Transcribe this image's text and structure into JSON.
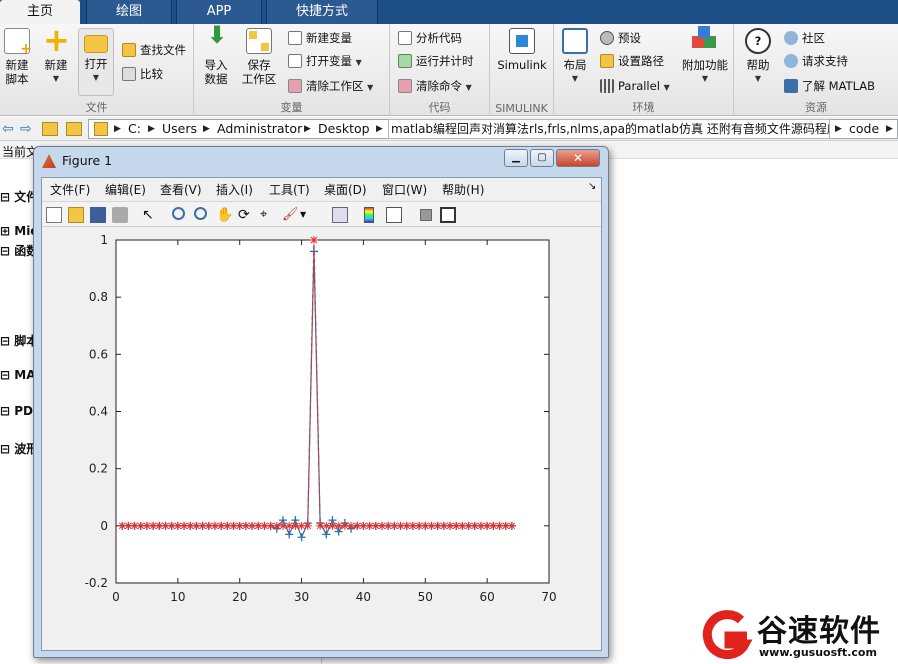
{
  "tabs": [
    "主页",
    "绘图",
    "APP",
    "快捷方式"
  ],
  "ribbon": {
    "file": {
      "label": "文件",
      "new_script": "新建\n脚本",
      "new": "新建",
      "open": "打开",
      "find_files": "查找文件",
      "compare": "比较"
    },
    "variable": {
      "label": "变量",
      "import_data": "导入\n数据",
      "save_workspace": "保存\n工作区",
      "new_variable": "新建变量",
      "open_variable": "打开变量",
      "clear_workspace": "清除工作区"
    },
    "code": {
      "label": "代码",
      "analyze_code": "分析代码",
      "run_and_time": "运行并计时",
      "clear_commands": "清除命令"
    },
    "simulink": {
      "label": "SIMULINK",
      "button": "Simulink"
    },
    "environment": {
      "label": "环境",
      "layout": "布局",
      "preferences": "预设",
      "set_path": "设置路径",
      "parallel": "Parallel",
      "addons": "附加功能"
    },
    "resources": {
      "label": "资源",
      "help": "帮助",
      "community": "社区",
      "request_support": "请求支持",
      "learn_matlab": "了解 MATLAB"
    }
  },
  "address": {
    "drive": "C:",
    "segments": [
      "Users",
      "Administrator",
      "Desktop",
      "matlab编程回声对消算法rls,frls,nlms,apa的matlab仿真 还附有音频文件源码程序",
      "code"
    ]
  },
  "left_panel": {
    "header": "当前文",
    "items": [
      "文件",
      "Mic",
      "函数",
      "脚本",
      "MA",
      "PDF",
      "波形"
    ]
  },
  "figure": {
    "title": "Figure 1",
    "menu": [
      "文件(F)",
      "编辑(E)",
      "查看(V)",
      "插入(I)",
      "工具(T)",
      "桌面(D)",
      "窗口(W)",
      "帮助(H)"
    ]
  },
  "chart_data": {
    "type": "line",
    "x_ticks": [
      0,
      10,
      20,
      30,
      40,
      50,
      60,
      70
    ],
    "y_ticks": [
      -0.2,
      0,
      0.2,
      0.4,
      0.6,
      0.8,
      1
    ],
    "xlim": [
      0,
      70
    ],
    "ylim": [
      -0.2,
      1
    ],
    "grid": false,
    "series": [
      {
        "marker": "*",
        "color": "#e0312f",
        "linestyle": "dashed",
        "x": [
          1,
          2,
          3,
          4,
          5,
          6,
          7,
          8,
          9,
          10,
          11,
          12,
          13,
          14,
          15,
          16,
          17,
          18,
          19,
          20,
          21,
          22,
          23,
          24,
          25,
          26,
          27,
          28,
          29,
          30,
          31,
          32,
          33,
          34,
          35,
          36,
          37,
          38,
          39,
          40,
          41,
          42,
          43,
          44,
          45,
          46,
          47,
          48,
          49,
          50,
          51,
          52,
          53,
          54,
          55,
          56,
          57,
          58,
          59,
          60,
          61,
          62,
          63,
          64
        ],
        "y": [
          0,
          0,
          0,
          0,
          0,
          0,
          0,
          0,
          0,
          0,
          0,
          0,
          0,
          0,
          0,
          0,
          0,
          0,
          0,
          0,
          0,
          0,
          0,
          0,
          0,
          0,
          0,
          0,
          0,
          0,
          0,
          1,
          0,
          0,
          0,
          0,
          0,
          0,
          0,
          0,
          0,
          0,
          0,
          0,
          0,
          0,
          0,
          0,
          0,
          0,
          0,
          0,
          0,
          0,
          0,
          0,
          0,
          0,
          0,
          0,
          0,
          0,
          0,
          0
        ]
      },
      {
        "marker": "+",
        "color": "#2b6fa8",
        "linestyle": "solid",
        "x": [
          1,
          2,
          3,
          4,
          5,
          6,
          7,
          8,
          9,
          10,
          11,
          12,
          13,
          14,
          15,
          16,
          17,
          18,
          19,
          20,
          21,
          22,
          23,
          24,
          25,
          26,
          27,
          28,
          29,
          30,
          31,
          32,
          33,
          34,
          35,
          36,
          37,
          38,
          39,
          40,
          41,
          42,
          43,
          44,
          45,
          46,
          47,
          48,
          49,
          50,
          51,
          52,
          53,
          54,
          55,
          56,
          57,
          58,
          59,
          60,
          61,
          62,
          63,
          64
        ],
        "y": [
          0,
          0,
          0,
          0,
          0,
          0,
          0,
          0,
          0,
          0,
          0,
          0,
          0,
          0,
          0,
          0,
          0,
          0,
          0,
          0,
          0,
          0,
          0,
          0,
          0,
          -0.01,
          0.02,
          -0.03,
          0.02,
          -0.04,
          0.01,
          0.96,
          0.01,
          -0.03,
          0.02,
          -0.02,
          0.01,
          -0.01,
          0,
          0,
          0,
          0,
          0,
          0,
          0,
          0,
          0,
          0,
          0,
          0,
          0,
          0,
          0,
          0,
          0,
          0,
          0,
          0,
          0,
          0,
          0,
          0,
          0,
          0
        ]
      }
    ]
  },
  "watermark": {
    "brand": "谷速软件",
    "url": "www.gusuosft.com",
    "color": "#e0231c"
  }
}
